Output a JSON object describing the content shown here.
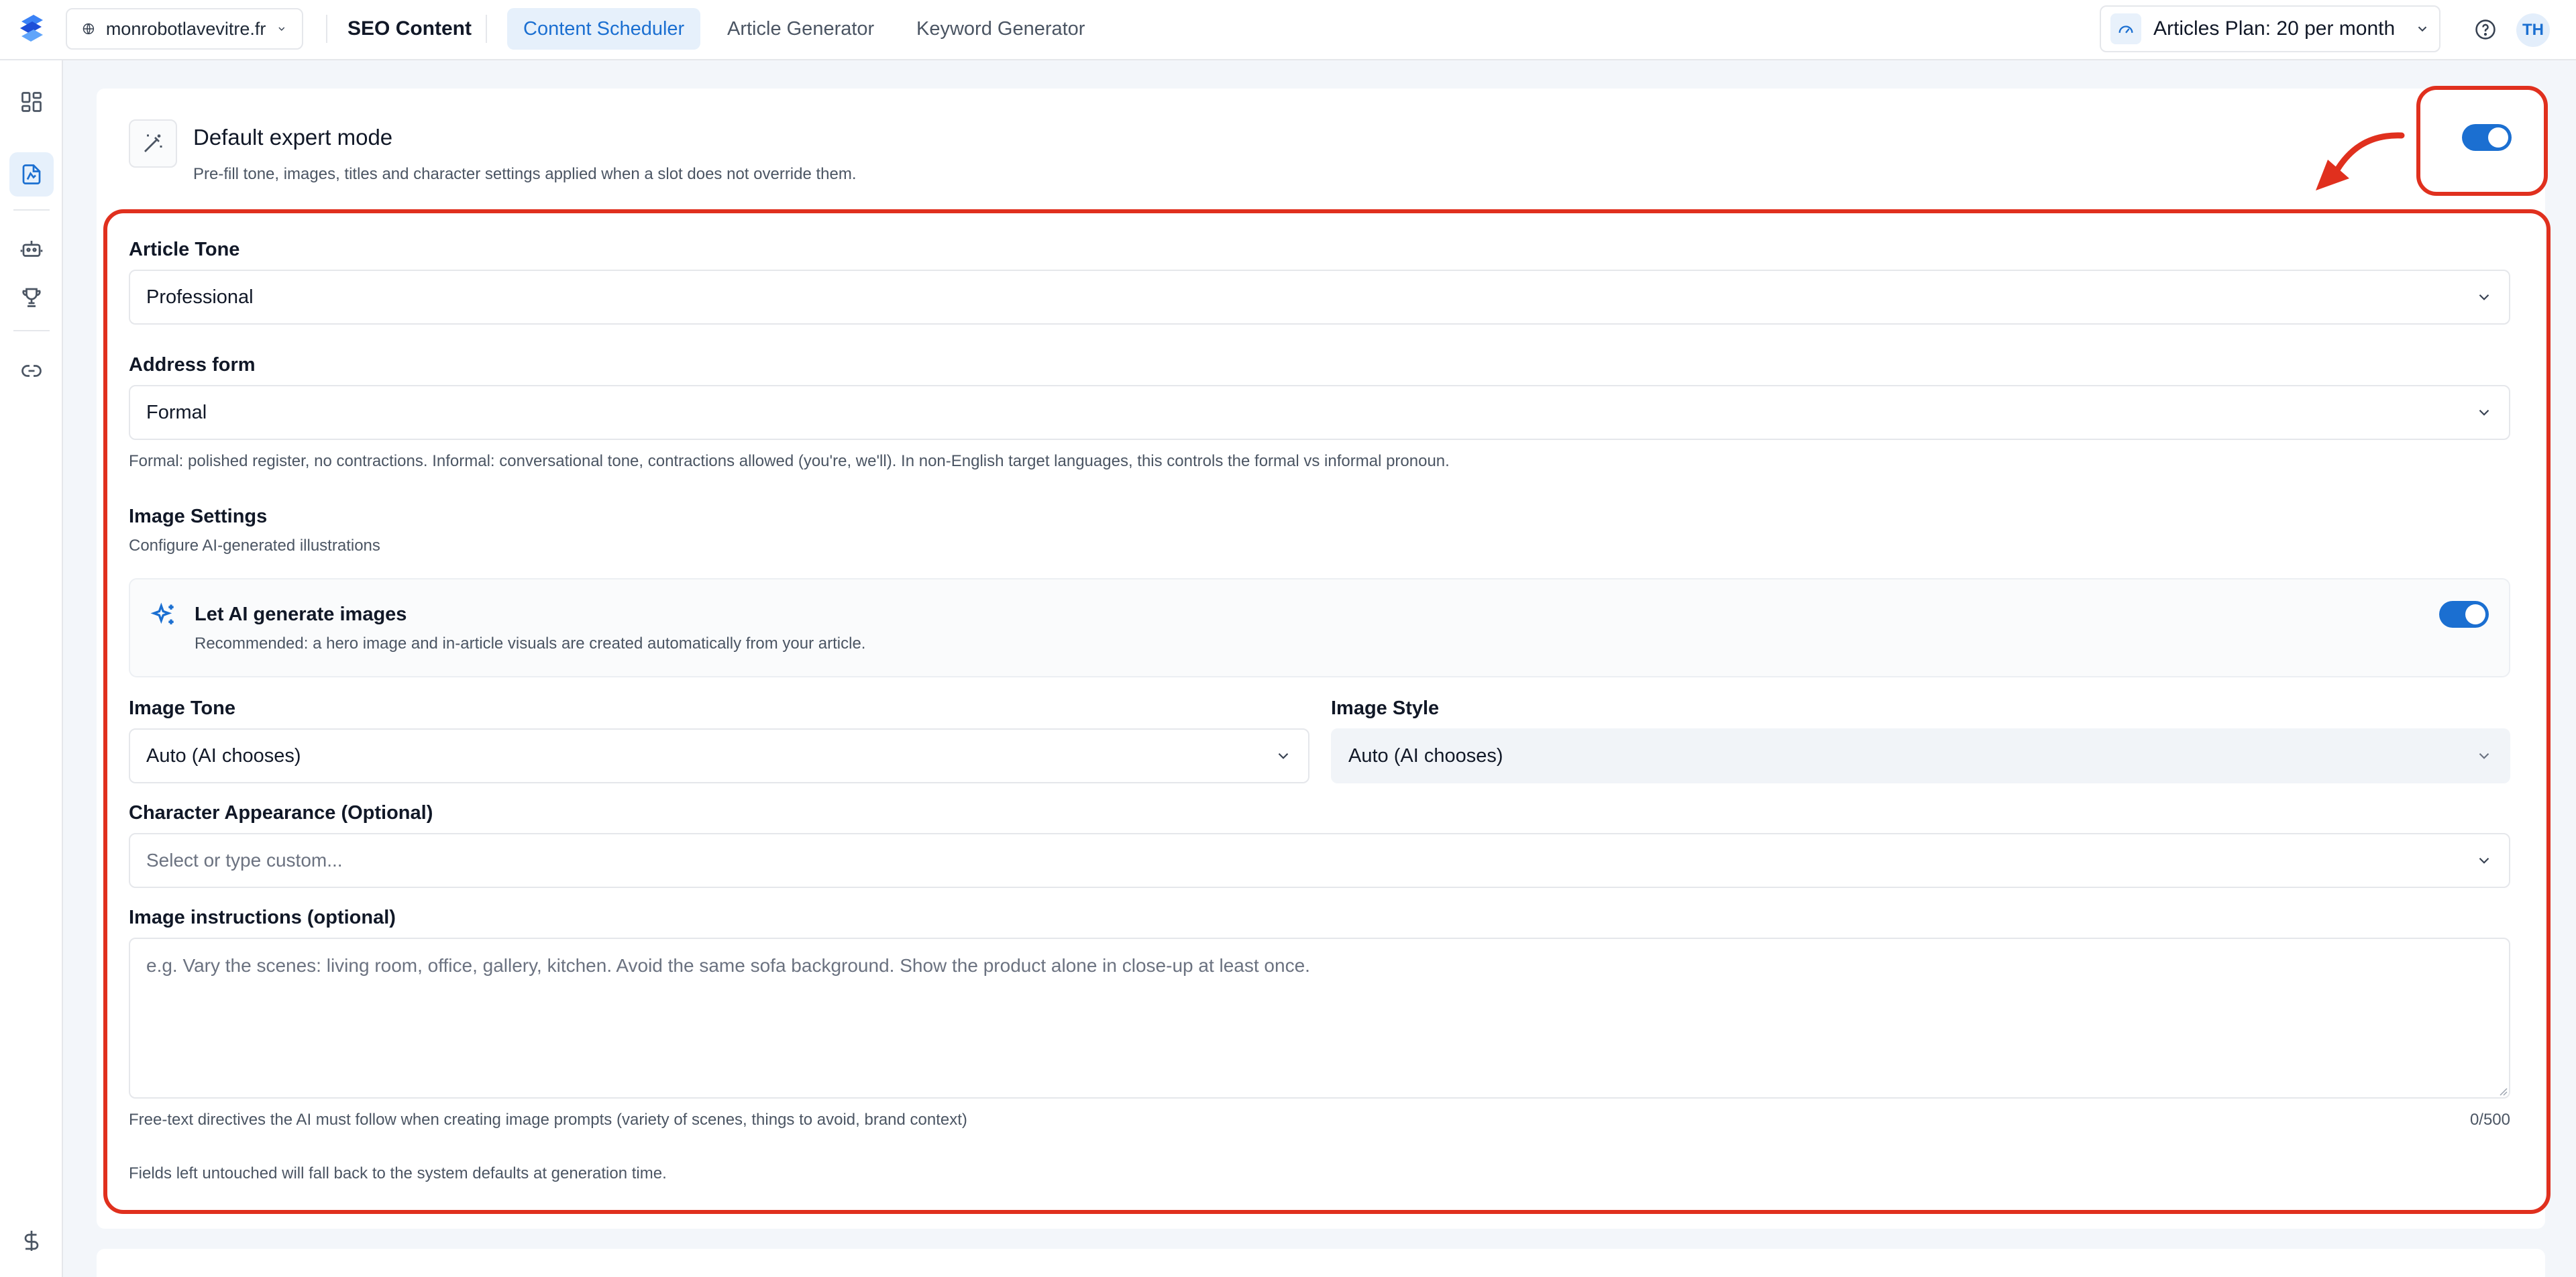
{
  "header": {
    "site": "monrobotlavevitre.fr",
    "section_title": "SEO Content",
    "tabs": [
      {
        "label": "Content Scheduler",
        "active": true
      },
      {
        "label": "Article Generator",
        "active": false
      },
      {
        "label": "Keyword Generator",
        "active": false
      }
    ],
    "plan_label": "Articles Plan: 20 per month",
    "avatar_initials": "TH"
  },
  "sidebar": {
    "items": [
      "dashboard-icon",
      "content-icon",
      "robot-icon",
      "trophy-icon",
      "link-icon",
      "dollar-icon"
    ],
    "active": "content-icon"
  },
  "expert_mode": {
    "title": "Default expert mode",
    "description": "Pre-fill tone, images, titles and character settings applied when a slot does not override them.",
    "enabled": true
  },
  "form": {
    "article_tone": {
      "label": "Article Tone",
      "value": "Professional"
    },
    "address_form": {
      "label": "Address form",
      "value": "Formal",
      "hint": "Formal: polished register, no contractions. Informal: conversational tone, contractions allowed (you're, we'll). In non-English target languages, this controls the formal vs informal pronoun."
    },
    "image_settings": {
      "title": "Image Settings",
      "subtitle": "Configure AI-generated illustrations",
      "ai_generate": {
        "title": "Let AI generate images",
        "description": "Recommended: a hero image and in-article visuals are created automatically from your article.",
        "enabled": true
      }
    },
    "image_tone": {
      "label": "Image Tone",
      "value": "Auto (AI chooses)"
    },
    "image_style": {
      "label": "Image Style",
      "value": "Auto (AI chooses)"
    },
    "character_appearance": {
      "label": "Character Appearance (Optional)",
      "placeholder": "Select or type custom..."
    },
    "image_instructions": {
      "label": "Image instructions (optional)",
      "placeholder": "e.g. Vary the scenes: living room, office, gallery, kitchen. Avoid the same sofa background. Show the product alone in close-up at least once.",
      "hint": "Free-text directives the AI must follow when creating image prompts (variety of scenes, things to avoid, brand context)",
      "counter": "0/500"
    },
    "footer_note": "Fields left untouched will fall back to the system defaults at generation time."
  },
  "colors": {
    "accent": "#1b6fd1",
    "annotation": "#e0301e",
    "background": "#f3f6fa"
  }
}
